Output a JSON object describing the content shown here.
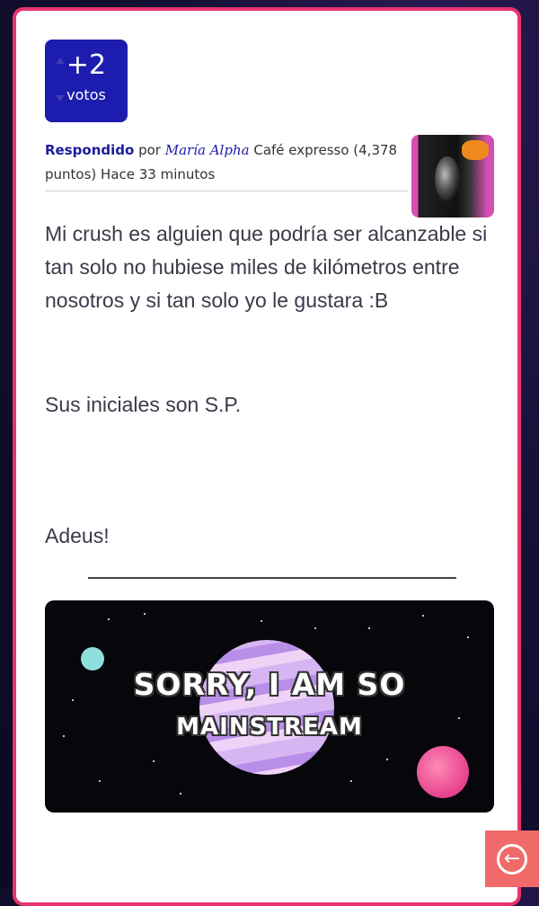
{
  "votes": {
    "count": "+2",
    "label": "votos"
  },
  "answer_meta": {
    "answered_label": "Respondido",
    "by": "por",
    "author": "María Alpha",
    "rank_points": "Café expresso (4,378 puntos)",
    "time": "Hace 33 minutos"
  },
  "answer": {
    "p1": "Mi crush es alguien que podría ser alcanzable si tan solo no hubiese miles de kilómetros entre nosotros y si tan solo yo le gustara :B",
    "p2": "Sus iniciales son S.P.",
    "p3": "Adeus!"
  },
  "banner": {
    "line1": "SORRY, I AM SO",
    "line2": "MAINSTREAM"
  },
  "icons": {
    "back": "arrow-left-circle-icon"
  },
  "colors": {
    "card_border": "#e8336d",
    "vote_bg": "#1c1cae",
    "back_button_bg": "#f06a6a"
  }
}
